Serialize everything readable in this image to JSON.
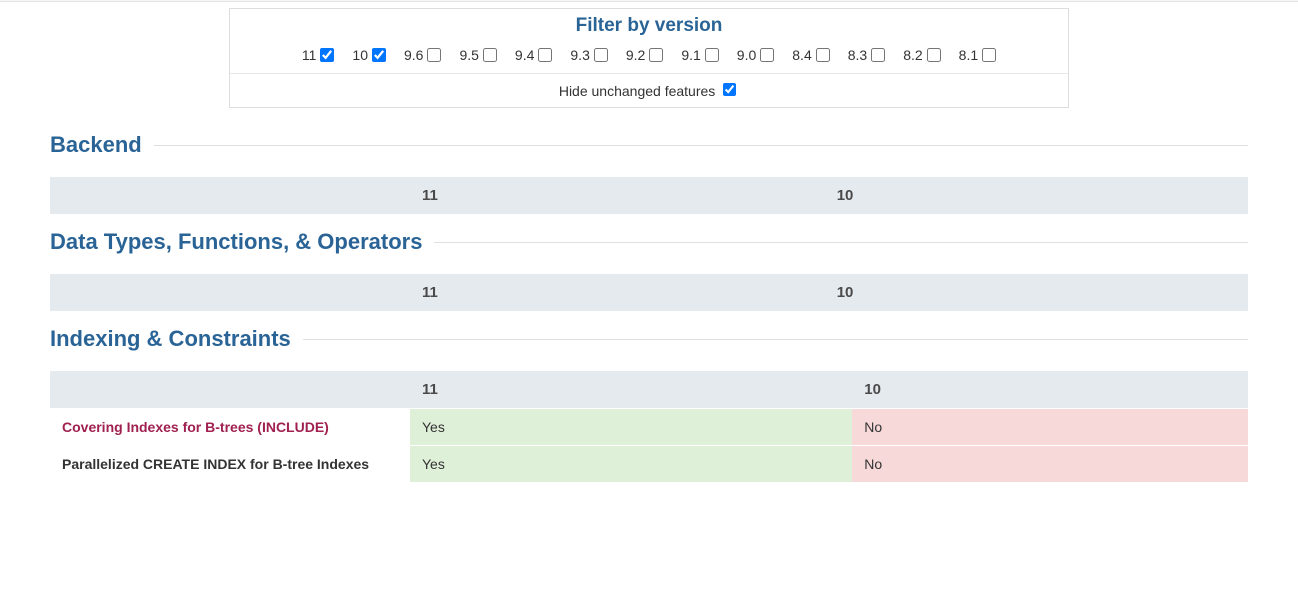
{
  "filter": {
    "title": "Filter by version",
    "versions": [
      {
        "label": "11",
        "checked": true
      },
      {
        "label": "10",
        "checked": true
      },
      {
        "label": "9.6",
        "checked": false
      },
      {
        "label": "9.5",
        "checked": false
      },
      {
        "label": "9.4",
        "checked": false
      },
      {
        "label": "9.3",
        "checked": false
      },
      {
        "label": "9.2",
        "checked": false
      },
      {
        "label": "9.1",
        "checked": false
      },
      {
        "label": "9.0",
        "checked": false
      },
      {
        "label": "8.4",
        "checked": false
      },
      {
        "label": "8.3",
        "checked": false
      },
      {
        "label": "8.2",
        "checked": false
      },
      {
        "label": "8.1",
        "checked": false
      }
    ],
    "hide_unchanged_label": "Hide unchanged features",
    "hide_unchanged_checked": true
  },
  "columns": [
    "11",
    "10"
  ],
  "sections": [
    {
      "title": "Backend",
      "rows": []
    },
    {
      "title": "Data Types, Functions, & Operators",
      "rows": []
    },
    {
      "title": "Indexing & Constraints",
      "rows": [
        {
          "name": "Covering Indexes for B-trees (INCLUDE)",
          "link": true,
          "cells": [
            {
              "value": "Yes",
              "status": "yes"
            },
            {
              "value": "No",
              "status": "no"
            }
          ]
        },
        {
          "name": "Parallelized CREATE INDEX for B-tree Indexes",
          "link": false,
          "cells": [
            {
              "value": "Yes",
              "status": "yes"
            },
            {
              "value": "No",
              "status": "no"
            }
          ]
        }
      ]
    }
  ]
}
